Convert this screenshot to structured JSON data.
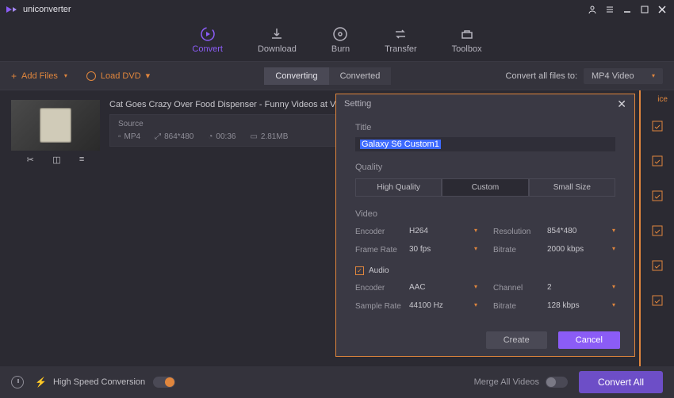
{
  "app": {
    "name": "uniconverter"
  },
  "tabs": {
    "convert": "Convert",
    "download": "Download",
    "burn": "Burn",
    "transfer": "Transfer",
    "toolbox": "Toolbox"
  },
  "toolbar": {
    "add_files": "Add Files",
    "load_dvd": "Load DVD",
    "converting": "Converting",
    "converted": "Converted",
    "convert_all_to": "Convert all files to:",
    "format": "MP4 Video"
  },
  "file": {
    "name": "Cat Goes Crazy Over Food Dispenser - Funny Videos at Videoba...",
    "source_label": "Source",
    "container": "MP4",
    "resolution": "864*480",
    "duration": "00:36",
    "size": "2.81MB"
  },
  "right_header": "ice",
  "bottom": {
    "hsc": "High Speed Conversion",
    "merge": "Merge All Videos",
    "convert_all": "Convert All"
  },
  "modal": {
    "title": "Setting",
    "title_label": "Title",
    "title_value": "Galaxy S6 Custom1",
    "quality_label": "Quality",
    "q_high": "High Quality",
    "q_custom": "Custom",
    "q_small": "Small Size",
    "video_label": "Video",
    "encoder_label": "Encoder",
    "framerate_label": "Frame Rate",
    "resolution_label": "Resolution",
    "bitrate_label": "Bitrate",
    "video": {
      "encoder": "H264",
      "framerate": "30 fps",
      "resolution": "854*480",
      "bitrate": "2000 kbps"
    },
    "audio_label": "Audio",
    "samplerate_label": "Sample Rate",
    "channel_label": "Channel",
    "audio": {
      "encoder": "AAC",
      "samplerate": "44100 Hz",
      "channel": "2",
      "bitrate": "128 kbps"
    },
    "create": "Create",
    "cancel": "Cancel"
  }
}
